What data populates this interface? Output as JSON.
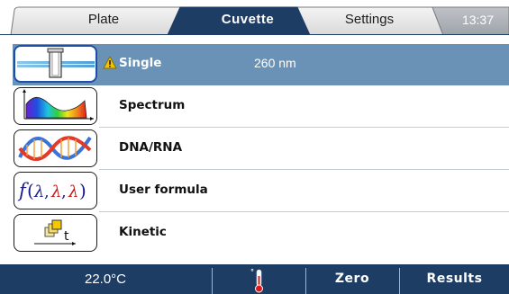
{
  "tabs": {
    "plate": "Plate",
    "cuvette": "Cuvette",
    "settings": "Settings",
    "clock": "13:37",
    "active": "Cuvette"
  },
  "methods": [
    {
      "label": "Single",
      "icon": "cuvette-icon",
      "selected": true,
      "warning": true,
      "wavelength": "260 nm"
    },
    {
      "label": "Spectrum",
      "icon": "spectrum-icon",
      "selected": false
    },
    {
      "label": "DNA/RNA",
      "icon": "dna-icon",
      "selected": false
    },
    {
      "label": "User formula",
      "icon": "formula-icon",
      "selected": false
    },
    {
      "label": "Kinetic",
      "icon": "kinetic-icon",
      "selected": false
    }
  ],
  "bottom": {
    "temperature": "22.0°C",
    "thermo_icon": "thermometer-icon",
    "zero": "Zero",
    "results": "Results"
  },
  "colors": {
    "active_tab": "#1e3d64",
    "selected_row": "#6a91b6",
    "bottom_bar": "#1e3d64",
    "warning": "#f2c400"
  }
}
